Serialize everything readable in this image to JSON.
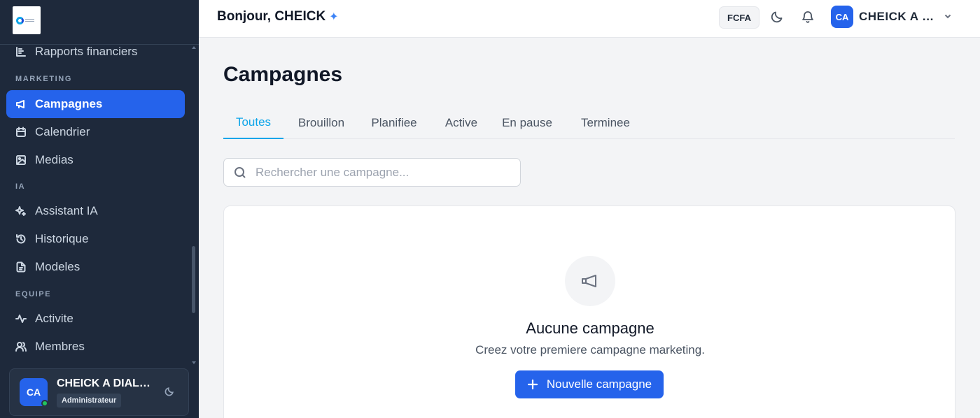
{
  "sidebar": {
    "items_top": [
      {
        "label": "Rapports financiers",
        "icon": "chart-icon"
      }
    ],
    "sections": {
      "marketing": "MARKETING",
      "ia": "IA",
      "equipe": "EQUIPE"
    },
    "marketing_items": [
      {
        "label": "Campagnes",
        "icon": "megaphone-icon",
        "active": true
      },
      {
        "label": "Calendrier",
        "icon": "calendar-icon"
      },
      {
        "label": "Medias",
        "icon": "image-icon"
      }
    ],
    "ia_items": [
      {
        "label": "Assistant IA",
        "icon": "sparkles-icon"
      },
      {
        "label": "Historique",
        "icon": "history-icon"
      },
      {
        "label": "Modeles",
        "icon": "file-icon"
      }
    ],
    "equipe_items": [
      {
        "label": "Activite",
        "icon": "activity-icon"
      },
      {
        "label": "Membres",
        "icon": "users-icon"
      }
    ],
    "user": {
      "initials": "CA",
      "name": "CHEICK A DIALLO",
      "role": "Administrateur"
    }
  },
  "topbar": {
    "greeting": "Bonjour, CHEICK",
    "sparkle": "✦",
    "currency": "FCFA",
    "user_initials": "CA",
    "user_name": "CHEICK A DIALLO"
  },
  "main": {
    "title": "Campagnes",
    "tabs": [
      {
        "label": "Toutes",
        "active": true
      },
      {
        "label": "Brouillon"
      },
      {
        "label": "Planifiee"
      },
      {
        "label": "Active"
      },
      {
        "label": "En pause"
      },
      {
        "label": "Terminee"
      }
    ],
    "search": {
      "placeholder": "Rechercher une campagne...",
      "value": ""
    },
    "empty_state": {
      "title": "Aucune campagne",
      "subtitle": "Creez votre premiere campagne marketing.",
      "button_label": "Nouvelle campagne"
    }
  },
  "colors": {
    "sidebar_bg": "#1e293b",
    "accent": "#2563eb",
    "tab_active": "#0ea5e9",
    "online": "#22c55e"
  }
}
